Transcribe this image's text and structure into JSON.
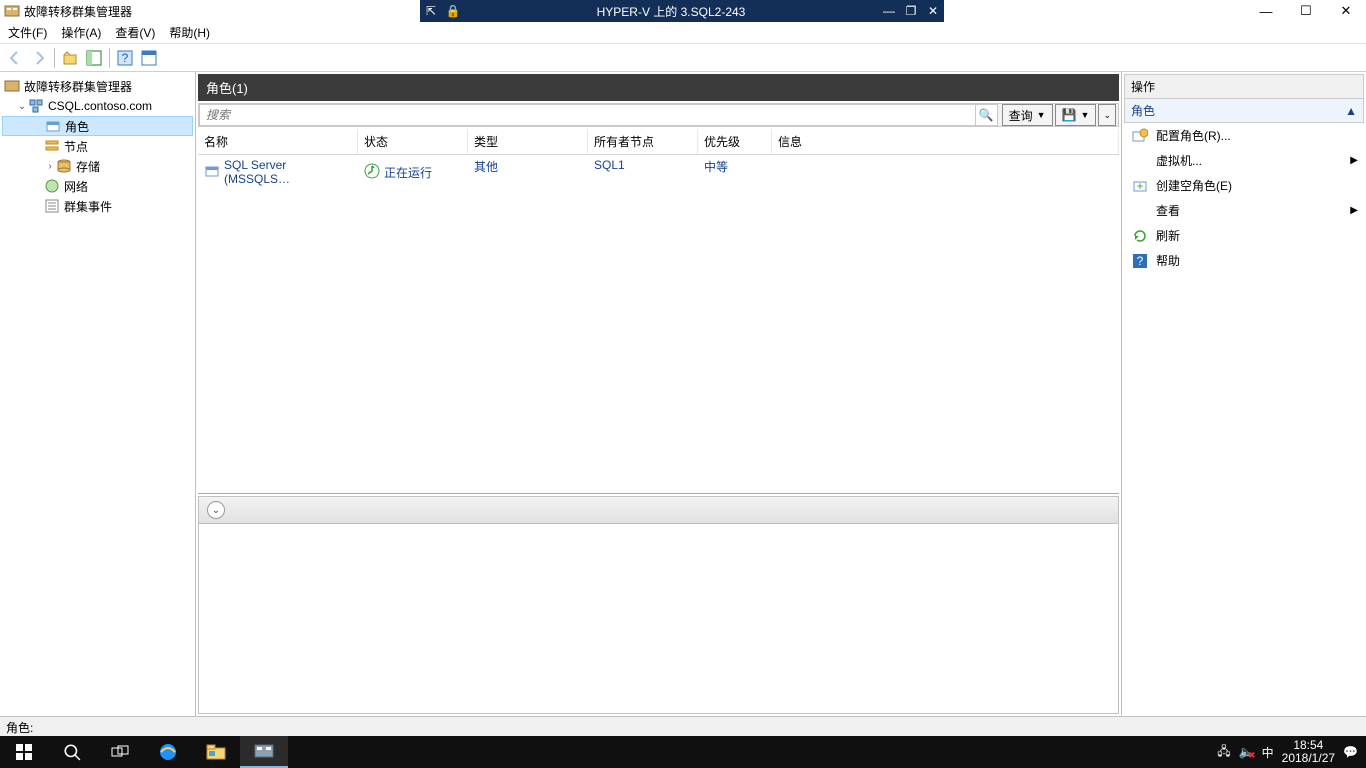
{
  "titlebar": {
    "app_title": "故障转移群集管理器",
    "vm_title": "HYPER-V 上的 3.SQL2-243"
  },
  "menu": {
    "file": "文件(F)",
    "action": "操作(A)",
    "view": "查看(V)",
    "help": "帮助(H)"
  },
  "tree": {
    "root": "故障转移群集管理器",
    "cluster": "CSQL.contoso.com",
    "items": [
      "角色",
      "节点",
      "存储",
      "网络",
      "群集事件"
    ]
  },
  "center": {
    "heading": "角色(1)",
    "search_placeholder": "搜索",
    "query_btn": "查询",
    "cols": {
      "name": "名称",
      "state": "状态",
      "type": "类型",
      "owner": "所有者节点",
      "priority": "优先级",
      "info": "信息"
    },
    "rows": [
      {
        "name": "SQL Server (MSSQLS…",
        "state": "正在运行",
        "type": "其他",
        "owner": "SQL1",
        "priority": "中等",
        "info": ""
      }
    ]
  },
  "actions": {
    "header": "操作",
    "group": "角色",
    "arrow_up": "▲",
    "items": [
      {
        "label": "配置角色(R)...",
        "icon": "configure",
        "arrow": false
      },
      {
        "label": "虚拟机...",
        "icon": "",
        "arrow": true
      },
      {
        "label": "创建空角色(E)",
        "icon": "create",
        "arrow": false
      },
      {
        "label": "查看",
        "icon": "",
        "arrow": true
      },
      {
        "label": "刷新",
        "icon": "refresh",
        "arrow": false
      },
      {
        "label": "帮助",
        "icon": "help",
        "arrow": false
      }
    ]
  },
  "statusbar": {
    "text": "角色:"
  },
  "taskbar": {
    "time": "18:54",
    "date": "2018/1/27",
    "ime": "中"
  }
}
